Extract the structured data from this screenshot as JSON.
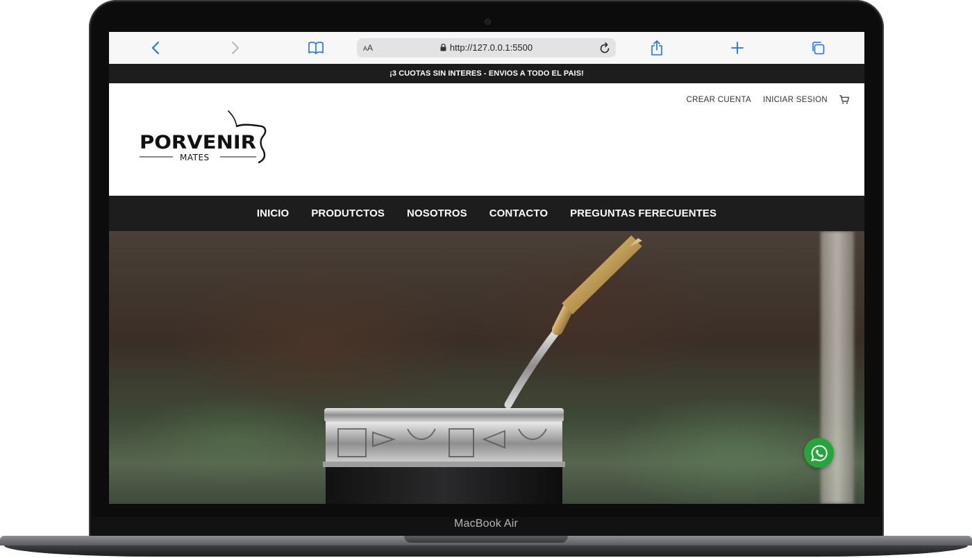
{
  "device": {
    "model_label": "MacBook Air"
  },
  "browser": {
    "text_size_label": "AA",
    "url": "http://127.0.0.1:5500"
  },
  "site": {
    "announcement": "¡3 CUOTAS SIN INTERES - ENVIOS A TODO EL PAIS!",
    "logo": {
      "brand": "PORVENIR",
      "sub": "MATES"
    },
    "account": {
      "create": "CREAR CUENTA",
      "login": "INICIAR SESION"
    },
    "nav": [
      "INICIO",
      "PRODUTCTOS",
      "NOSOTROS",
      "CONTACTO",
      "PREGUNTAS FERECUENTES"
    ]
  },
  "colors": {
    "dark_bar": "#1d1d1d",
    "whatsapp": "#25a53a",
    "safari_blue": "#1a73e8"
  }
}
